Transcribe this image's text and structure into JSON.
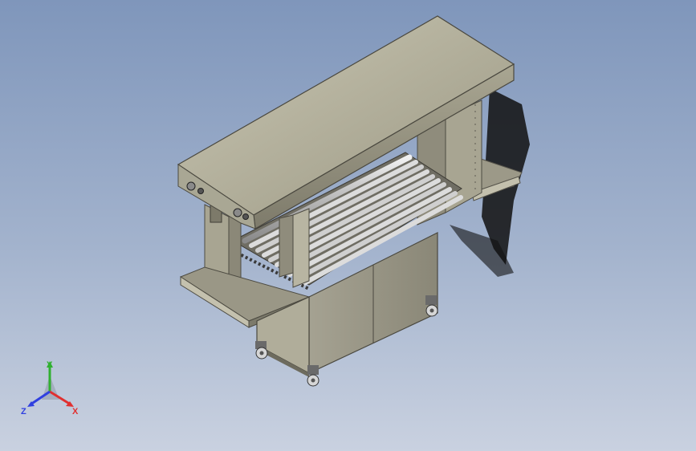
{
  "triad": {
    "x_label": "X",
    "y_label": "Y",
    "z_label": "Z",
    "x_color": "#e03030",
    "y_color": "#30b030",
    "z_color": "#3040e0"
  },
  "colors": {
    "background_top": "#7f96bb",
    "background_bottom": "#c9d1e0",
    "frame_metal": "#b5b29c",
    "frame_dark": "#7d7a6a",
    "roller": "#d8d8d8",
    "shadow": "#1a1a1a"
  }
}
